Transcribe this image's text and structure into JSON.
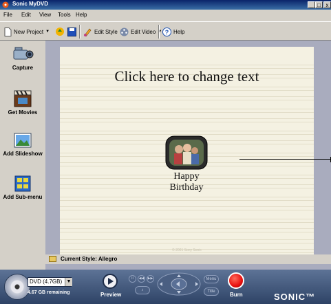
{
  "window": {
    "title": "Sonic MyDVD",
    "controls": [
      "_",
      "□",
      "x"
    ]
  },
  "menu": [
    "File",
    "Edit",
    "View",
    "Tools",
    "Help"
  ],
  "toolbar": {
    "new_project": "New Project",
    "edit_style": "Edit Style",
    "edit_video": "Edit Video",
    "help": "Help"
  },
  "sidebar": {
    "items": [
      {
        "label": "Capture",
        "icon": "camcorder-icon"
      },
      {
        "label": "Get Movies",
        "icon": "film-clapper-icon"
      },
      {
        "label": "Add Slideshow",
        "icon": "picture-icon"
      },
      {
        "label": "Add Sub-menu",
        "icon": "submenu-icon"
      }
    ]
  },
  "canvas": {
    "title_text": "Click here to change text",
    "button_label_line1": "Happy",
    "button_label_line2": "Birthday",
    "copyright": "© 2001 Sony Sonic"
  },
  "style_bar": {
    "text": "Current Style: Allegro"
  },
  "bottom": {
    "disc_type": "DVD (4.7GB)",
    "remaining": "4.67 GB remaining",
    "preview": "Preview",
    "burn": "Burn",
    "menu_btn": "Menu",
    "title_btn": "Title",
    "brand": "SONIC™"
  },
  "colors": {
    "burn": "#e81010",
    "title_bar": "#0a246a",
    "canvas_bg": "#f4f1e2",
    "bottom_bar": "#3d5378"
  }
}
